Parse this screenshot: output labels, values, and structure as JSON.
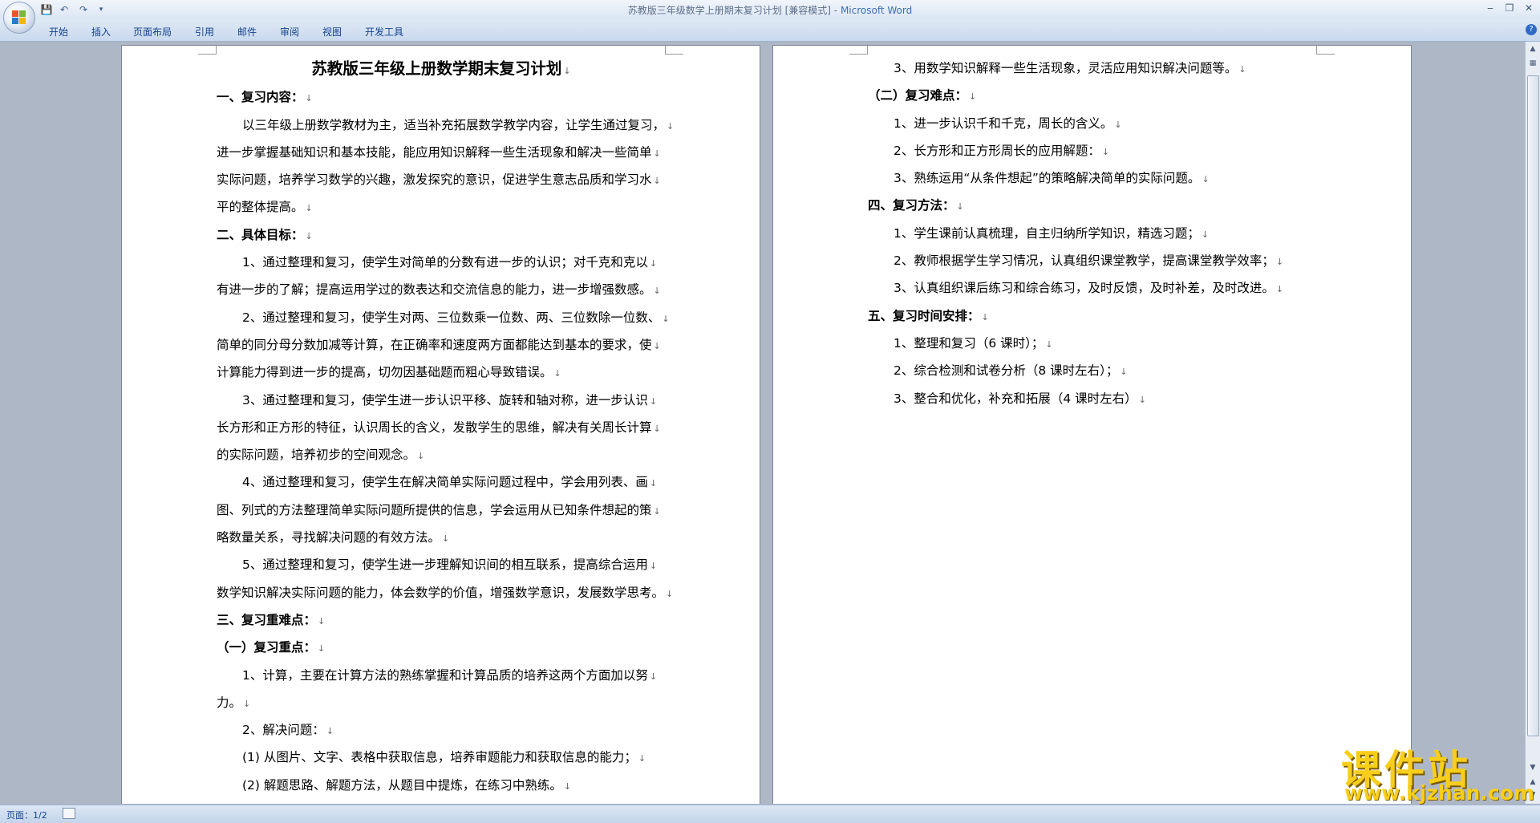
{
  "window": {
    "title": "苏教版三年级数学上册期末复习计划 [兼容模式]",
    "title_sep": " - ",
    "app_name": "Microsoft Word",
    "minimize": "‒",
    "restore": "❐",
    "close": "✕"
  },
  "quick_access": {
    "save_icon": "save-icon",
    "undo_icon": "undo-icon",
    "redo_icon": "redo-icon",
    "customize_icon": "dropdown-icon"
  },
  "ribbon": {
    "tabs": [
      "开始",
      "插入",
      "页面布局",
      "引用",
      "邮件",
      "审阅",
      "视图",
      "开发工具"
    ],
    "help": "?"
  },
  "document": {
    "page1": [
      {
        "style": "title",
        "text": "苏教版三年级上册数学期末复习计划"
      },
      {
        "style": "h",
        "text": "一、复习内容："
      },
      {
        "style": "ind",
        "text": "以三年级上册数学教材为主，适当补充拓展数学教学内容，让学生通过复习，"
      },
      {
        "style": "p",
        "text": "进一步掌握基础知识和基本技能，能应用知识解释一些生活现象和解决一些简单"
      },
      {
        "style": "p",
        "text": "实际问题，培养学习数学的兴趣，激发探究的意识，促进学生意志品质和学习水"
      },
      {
        "style": "p",
        "text": "平的整体提高。"
      },
      {
        "style": "h",
        "text": "二、具体目标："
      },
      {
        "style": "ind",
        "text": "1、通过整理和复习，使学生对简单的分数有进一步的认识；对千克和克以"
      },
      {
        "style": "p",
        "text": "有进一步的了解；提高运用学过的数表达和交流信息的能力，进一步增强数感。"
      },
      {
        "style": "ind",
        "text": "2、通过整理和复习，使学生对两、三位数乘一位数、两、三位数除一位数、"
      },
      {
        "style": "p",
        "text": "简单的同分母分数加减等计算，在正确率和速度两方面都能达到基本的要求，使"
      },
      {
        "style": "p",
        "text": "计算能力得到进一步的提高，切勿因基础题而粗心导致错误。"
      },
      {
        "style": "ind",
        "text": "3、通过整理和复习，使学生进一步认识平移、旋转和轴对称，进一步认识"
      },
      {
        "style": "p",
        "text": "长方形和正方形的特征，认识周长的含义，发散学生的思维，解决有关周长计算"
      },
      {
        "style": "p",
        "text": "的实际问题，培养初步的空间观念。"
      },
      {
        "style": "ind",
        "text": "4、通过整理和复习，使学生在解决简单实际问题过程中，学会用列表、画"
      },
      {
        "style": "p",
        "text": "图、列式的方法整理简单实际问题所提供的信息，学会运用从已知条件想起的策"
      },
      {
        "style": "p",
        "text": "略数量关系，寻找解决问题的有效方法。"
      },
      {
        "style": "ind",
        "text": "5、通过整理和复习，使学生进一步理解知识间的相互联系，提高综合运用"
      },
      {
        "style": "p",
        "text": "数学知识解决实际问题的能力，体会数学的价值，增强数学意识，发展数学思考。"
      },
      {
        "style": "h",
        "text": "三、复习重难点："
      },
      {
        "style": "h",
        "text": "（一）复习重点："
      },
      {
        "style": "ind",
        "text": "1、计算，主要在计算方法的熟练掌握和计算品质的培养这两个方面加以努"
      },
      {
        "style": "p",
        "text": "力。"
      },
      {
        "style": "ind",
        "text": "2、解决问题："
      },
      {
        "style": "ind",
        "text": "(1) 从图片、文字、表格中获取信息，培养审题能力和获取信息的能力；"
      },
      {
        "style": "ind",
        "text": "(2) 解题思路、解题方法，从题目中提炼，在练习中熟练。"
      }
    ],
    "page2": [
      {
        "style": "ind",
        "text": "3、用数学知识解释一些生活现象，灵活应用知识解决问题等。"
      },
      {
        "style": "h",
        "text": "（二）复习难点："
      },
      {
        "style": "ind",
        "text": "1、进一步认识千和千克，周长的含义。"
      },
      {
        "style": "ind",
        "text": "2、长方形和正方形周长的应用解题："
      },
      {
        "style": "ind",
        "text": "3、熟练运用“从条件想起”的策略解决简单的实际问题。"
      },
      {
        "style": "h",
        "text": "四、复习方法："
      },
      {
        "style": "ind",
        "text": "1、学生课前认真梳理，自主归纳所学知识，精选习题；"
      },
      {
        "style": "ind",
        "text": "2、教师根据学生学习情况，认真组织课堂教学，提高课堂教学效率；"
      },
      {
        "style": "ind",
        "text": "3、认真组织课后练习和综合练习，及时反馈，及时补差，及时改进。"
      },
      {
        "style": "h",
        "text": "五、复习时间安排："
      },
      {
        "style": "ind",
        "text": "1、整理和复习（6 课时）；"
      },
      {
        "style": "ind",
        "text": "2、综合检测和试卷分析（8 课时左右）；"
      },
      {
        "style": "ind",
        "text": "3、整合和优化，补充和拓展（4 课时左右）"
      }
    ]
  },
  "paragraph_mark": "↓",
  "status_bar": {
    "pages": "页面：1/2"
  },
  "watermark": {
    "text": "课件站",
    "url": "www.kjzhan.com"
  },
  "colors": {
    "ribbon_text": "#15428b",
    "workspace": "#aeb7c6",
    "watermark": "#f7ce1a"
  }
}
